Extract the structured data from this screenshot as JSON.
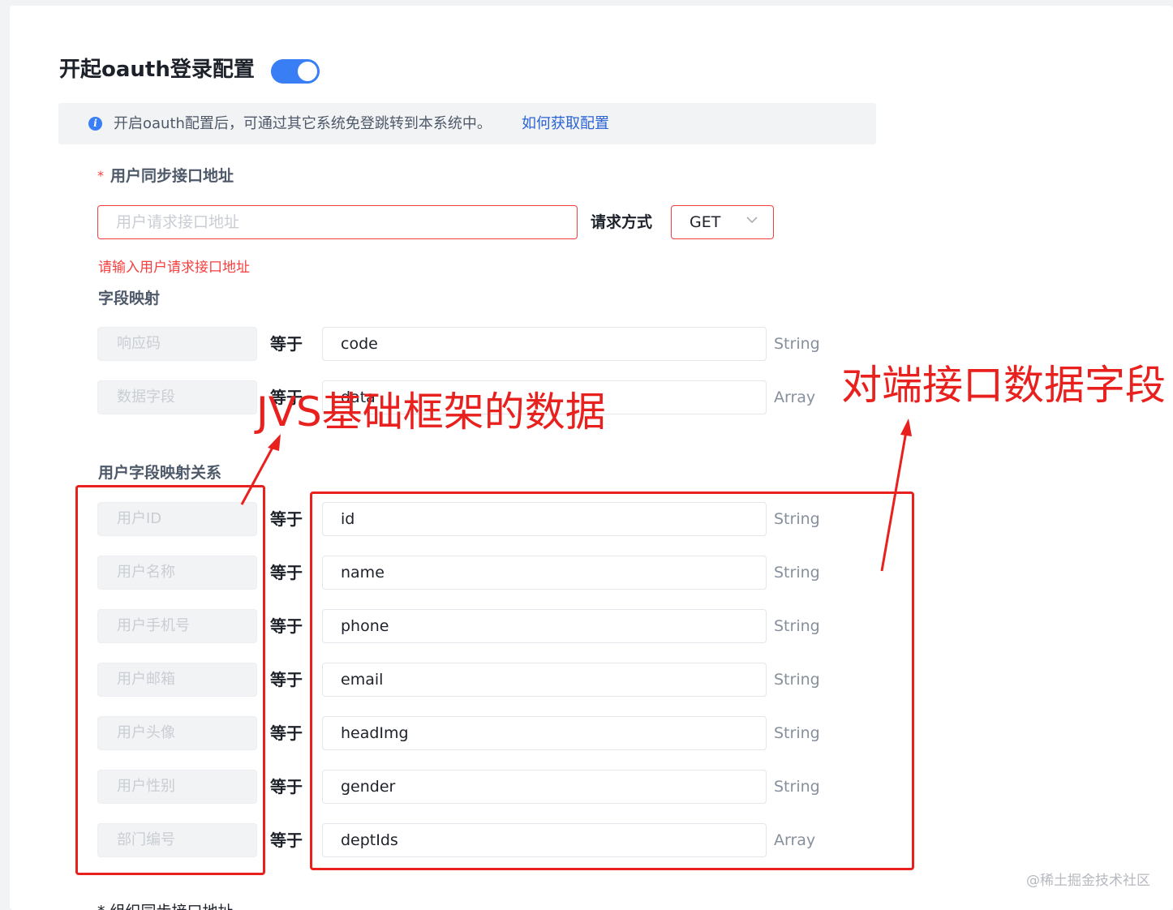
{
  "page": {
    "title": "开起oauth登录配置",
    "toggle_on": true,
    "accent_color": "#3a7ef6",
    "error_color": "#f53f3f",
    "annotation_color": "#e8201e"
  },
  "notice": {
    "icon": "info-icon",
    "text": "开启oauth配置后，可通过其它系统免登跳转到本系统中。",
    "link": "如何获取配置"
  },
  "sync": {
    "required_mark": "*",
    "label": "用户同步接口地址",
    "url_placeholder": "用户请求接口地址",
    "method_label": "请求方式",
    "method_value": "GET",
    "error": "请输入用户请求接口地址"
  },
  "field_mapping": {
    "title": "字段映射",
    "rows": [
      {
        "left": "响应码",
        "eq": "等于",
        "value": "code",
        "type": "String"
      },
      {
        "left": "数据字段",
        "eq": "等于",
        "value": "data",
        "type": "Array"
      }
    ]
  },
  "user_mapping": {
    "title": "用户字段映射关系",
    "rows": [
      {
        "left": "用户ID",
        "eq": "等于",
        "value": "id",
        "type": "String"
      },
      {
        "left": "用户名称",
        "eq": "等于",
        "value": "name",
        "type": "String"
      },
      {
        "left": "用户手机号",
        "eq": "等于",
        "value": "phone",
        "type": "String"
      },
      {
        "left": "用户邮箱",
        "eq": "等于",
        "value": "email",
        "type": "String"
      },
      {
        "left": "用户头像",
        "eq": "等于",
        "value": "headImg",
        "type": "String"
      },
      {
        "left": "用户性别",
        "eq": "等于",
        "value": "gender",
        "type": "String"
      },
      {
        "left": "部门编号",
        "eq": "等于",
        "value": "deptIds",
        "type": "Array"
      }
    ]
  },
  "annotations": {
    "left": "JVS基础框架的数据",
    "right": "对端接口数据字段"
  },
  "next_section_label": "* 组织同步接口地址",
  "watermark": "@稀土掘金技术社区"
}
